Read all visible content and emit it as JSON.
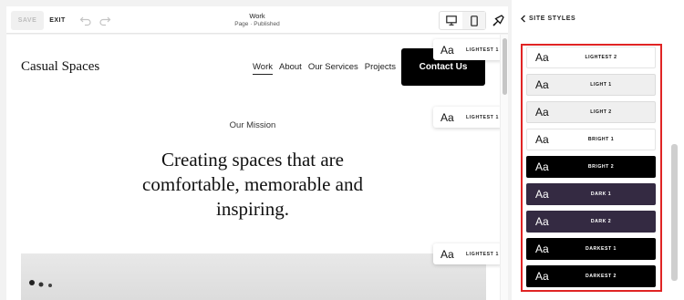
{
  "toolbar": {
    "save_label": "SAVE",
    "exit_label": "EXIT",
    "undo_icon": "undo-icon",
    "redo_icon": "redo-icon",
    "page_title": "Work",
    "page_status": "Page · Published",
    "desktop_icon": "desktop-icon",
    "mobile_icon": "mobile-icon",
    "styles_icon": "paintbrush-icon"
  },
  "site": {
    "logo": "Casual Spaces",
    "nav": [
      "Work",
      "About",
      "Our Services",
      "Projects"
    ],
    "active_nav": "Work",
    "cta_label": "Contact Us",
    "mission_label": "Our Mission",
    "headline": "Creating spaces that are comfortable, memorable and inspiring."
  },
  "section_chips": [
    {
      "aa": "Aa",
      "label": "LIGHTEST 1"
    },
    {
      "aa": "Aa",
      "label": "LIGHTEST 1"
    },
    {
      "aa": "Aa",
      "label": "LIGHTEST 1"
    }
  ],
  "panel": {
    "back_icon": "chevron-left-icon",
    "title": "SITE STYLES",
    "themes": [
      {
        "aa": "Aa",
        "label": "LIGHTEST 2",
        "bg": "#ffffff",
        "fg": "#111111",
        "border": "#e4e4e4"
      },
      {
        "aa": "Aa",
        "label": "LIGHT 1",
        "bg": "#efefef",
        "fg": "#111111",
        "border": "#dcdcdc"
      },
      {
        "aa": "Aa",
        "label": "LIGHT 2",
        "bg": "#efefef",
        "fg": "#111111",
        "border": "#dcdcdc"
      },
      {
        "aa": "Aa",
        "label": "BRIGHT 1",
        "bg": "#ffffff",
        "fg": "#111111",
        "border": "#e4e4e4"
      },
      {
        "aa": "Aa",
        "label": "BRIGHT 2",
        "bg": "#000000",
        "fg": "#ffffff",
        "border": "#000000"
      },
      {
        "aa": "Aa",
        "label": "DARK 1",
        "bg": "#342a42",
        "fg": "#ffffff",
        "border": "#342a42"
      },
      {
        "aa": "Aa",
        "label": "DARK 2",
        "bg": "#342a42",
        "fg": "#ffffff",
        "border": "#342a42"
      },
      {
        "aa": "Aa",
        "label": "DARKEST 1",
        "bg": "#000000",
        "fg": "#ffffff",
        "border": "#000000"
      },
      {
        "aa": "Aa",
        "label": "DARKEST 2",
        "bg": "#000000",
        "fg": "#ffffff",
        "border": "#000000"
      }
    ]
  },
  "colors": {
    "highlight": "#e02424",
    "cta_bg": "#000000"
  }
}
